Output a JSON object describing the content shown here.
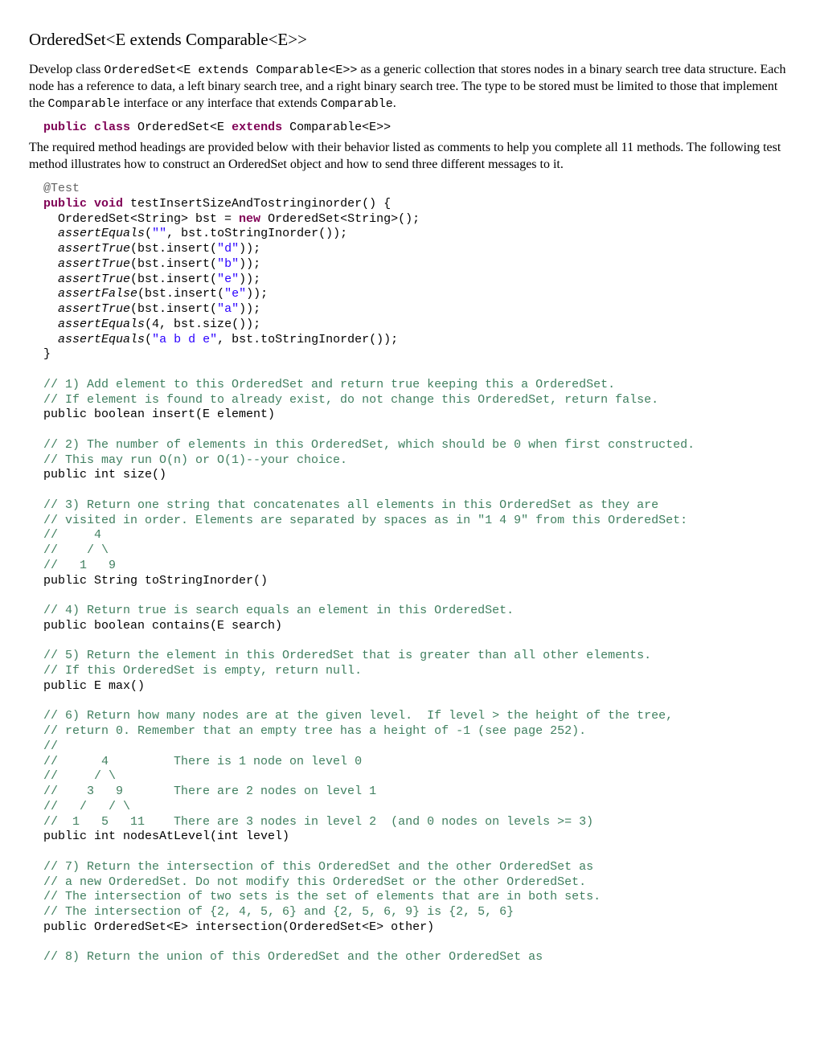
{
  "title": "OrderedSet<E extends Comparable<E>>",
  "intro": {
    "a": "Develop class ",
    "b": "OrderedSet<E extends Comparable<E>>",
    "c": " as a generic collection that stores nodes in a binary search tree data structure.  Each node has a reference to data, a left binary search tree, and a right binary search tree. The type to be stored must be limited to those that implement the ",
    "d": "Comparable",
    "e": " interface or any interface that extends ",
    "f": "Comparable",
    "g": "."
  },
  "classSig": {
    "a": "public class",
    "b": " OrderedSet<E ",
    "c": "extends",
    "d": " Comparable<E>>"
  },
  "para2": "The required method headings are provided below with their behavior listed as comments to help you complete all 11 methods. The following test method illustrates how to construct an OrderedSet object and how to send three different messages to it.",
  "test": {
    "ann": "@Test",
    "sigA": "public void",
    "sigB": " testInsertSizeAndTostringinorder() {",
    "l1a": "  OrderedSet<String> bst = ",
    "l1b": "new",
    "l1c": " OrderedSet<String>();",
    "l2a": "  ",
    "l2fn": "assertEquals",
    "l2b": "(",
    "l2s": "\"\"",
    "l2c": ", bst.toStringInorder());",
    "l3a": "  ",
    "l3fn": "assertTrue",
    "l3b": "(bst.insert(",
    "l3s": "\"d\"",
    "l3c": "));",
    "l4a": "  ",
    "l4fn": "assertTrue",
    "l4b": "(bst.insert(",
    "l4s": "\"b\"",
    "l4c": "));",
    "l5a": "  ",
    "l5fn": "assertTrue",
    "l5b": "(bst.insert(",
    "l5s": "\"e\"",
    "l5c": "));",
    "l6a": "  ",
    "l6fn": "assertFalse",
    "l6b": "(bst.insert(",
    "l6s": "\"e\"",
    "l6c": "));",
    "l7a": "  ",
    "l7fn": "assertTrue",
    "l7b": "(bst.insert(",
    "l7s": "\"a\"",
    "l7c": "));",
    "l8a": "  ",
    "l8fn": "assertEquals",
    "l8b": "(4, bst.size());",
    "l9a": "  ",
    "l9fn": "assertEquals",
    "l9b": "(",
    "l9s": "\"a b d e\"",
    "l9c": ", bst.toStringInorder());",
    "close": "}"
  },
  "m1": {
    "c1": "// 1) Add element to this OrderedSet and return true keeping this a OrderedSet.",
    "c2": "// If element is found to already exist, do not change this OrderedSet, return false.",
    "sig": "public boolean insert(E element)"
  },
  "m2": {
    "c1": "// 2) The number of elements in this OrderedSet, which should be 0 when first constructed.",
    "c2": "// This may run O(n) or O(1)--your choice.",
    "sig": "public int size()"
  },
  "m3": {
    "c1": "// 3) Return one string that concatenates all elements in this OrderedSet as they are",
    "c2": "// visited in order. Elements are separated by spaces as in \"1 4 9\" from this OrderedSet:",
    "c3": "//     4",
    "c4": "//    / \\",
    "c5": "//   1   9",
    "sig": "public String toStringInorder()"
  },
  "m4": {
    "c1": "// 4) Return true is search equals an element in this OrderedSet.",
    "sig": "public boolean contains(E search)"
  },
  "m5": {
    "c1": "// 5) Return the element in this OrderedSet that is greater than all other elements.",
    "c2": "// If this OrderedSet is empty, return null.",
    "sig": "public E max()"
  },
  "m6": {
    "c1": "// 6) Return how many nodes are at the given level.  If level > the height of the tree,",
    "c2": "// return 0. Remember that an empty tree has a height of -1 (see page 252).",
    "c3": "//",
    "c4": "//      4         There is 1 node on level 0",
    "c5": "//     / \\",
    "c6": "//    3   9       There are 2 nodes on level 1",
    "c7": "//   /   / \\",
    "c8": "//  1   5   11    There are 3 nodes in level 2  (and 0 nodes on levels >= 3)",
    "sig": "public int nodesAtLevel(int level)"
  },
  "m7": {
    "c1": "// 7) Return the intersection of this OrderedSet and the other OrderedSet as",
    "c2": "// a new OrderedSet. Do not modify this OrderedSet or the other OrderedSet.",
    "c3": "// The intersection of two sets is the set of elements that are in both sets.",
    "c4": "// The intersection of {2, 4, 5, 6} and {2, 5, 6, 9} is {2, 5, 6}",
    "sig": "public OrderedSet<E> intersection(OrderedSet<E> other)"
  },
  "m8": {
    "c1": "// 8) Return the union of this OrderedSet and the other OrderedSet as"
  }
}
